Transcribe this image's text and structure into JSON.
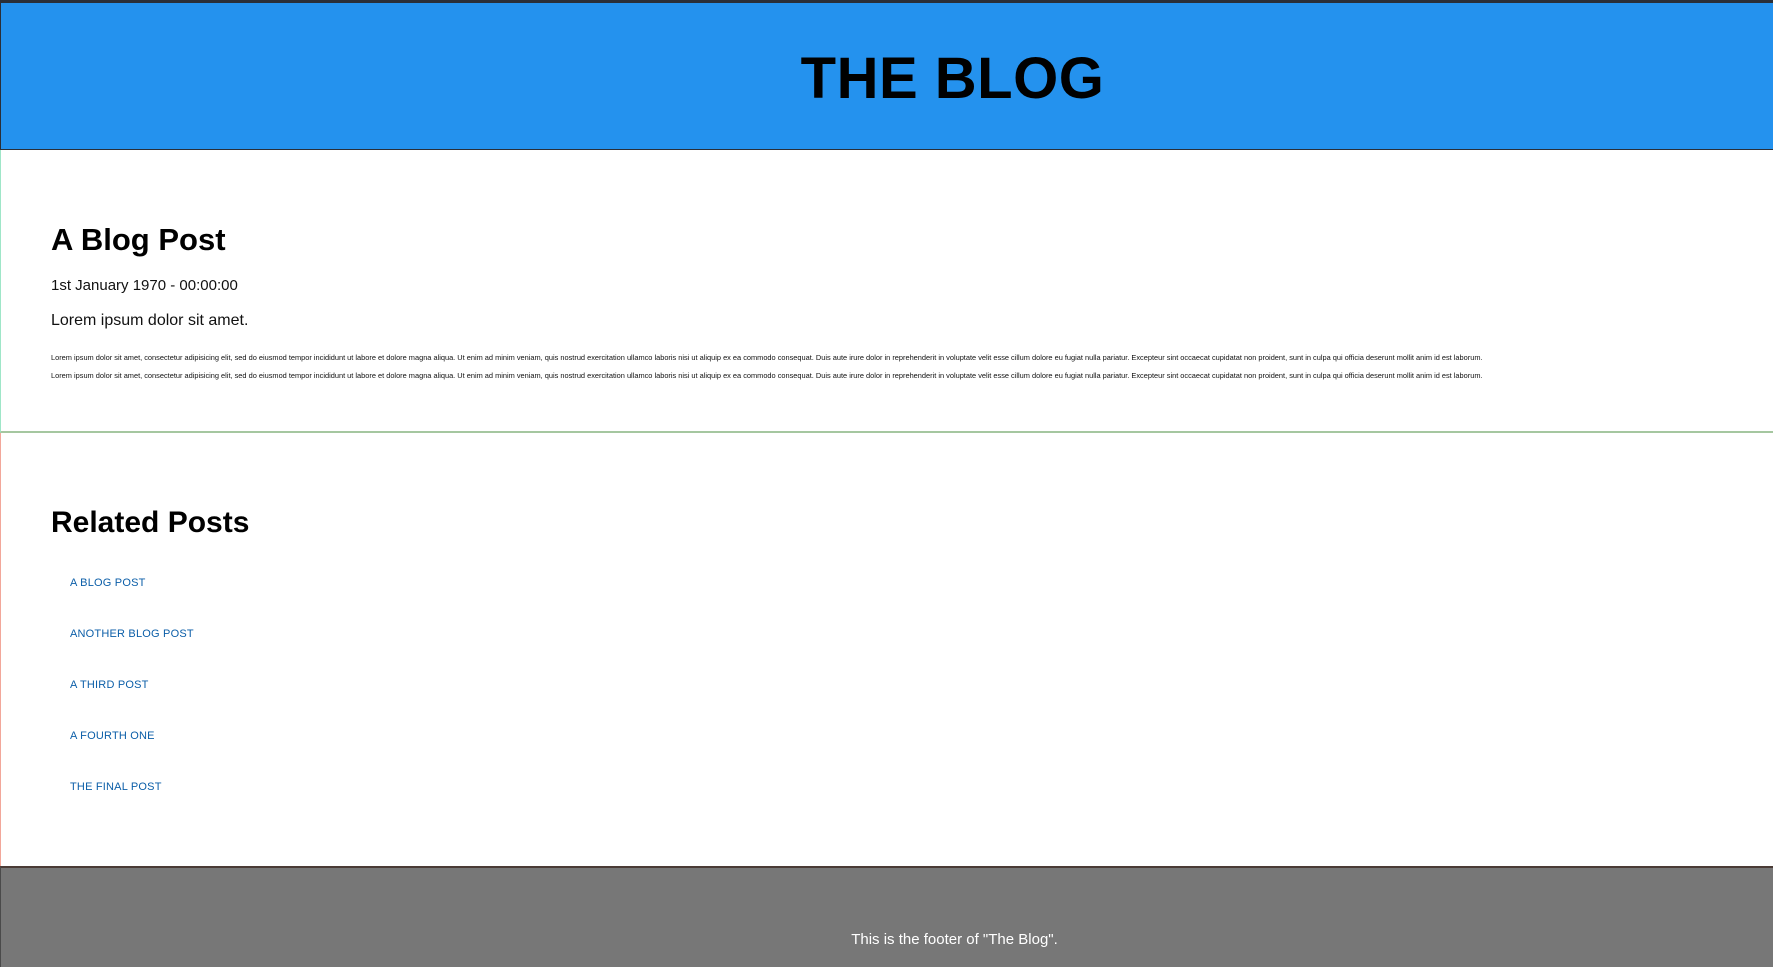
{
  "header": {
    "title": "THE BLOG"
  },
  "post": {
    "title": "A Blog Post",
    "date": "1st January 1970 - 00:00:00",
    "lead": "Lorem ipsum dolor sit amet.",
    "paragraphs": [
      "Lorem ipsum dolor sit amet, consectetur adipisicing elit, sed do eiusmod tempor incididunt ut labore et dolore magna aliqua. Ut enim ad minim veniam, quis nostrud exercitation ullamco laboris nisi ut aliquip ex ea commodo consequat. Duis aute irure dolor in reprehenderit in voluptate velit esse cillum dolore eu fugiat nulla pariatur. Excepteur sint occaecat cupidatat non proident, sunt in culpa qui officia deserunt mollit anim id est laborum.",
      "Lorem ipsum dolor sit amet, consectetur adipisicing elit, sed do eiusmod tempor incididunt ut labore et dolore magna aliqua. Ut enim ad minim veniam, quis nostrud exercitation ullamco laboris nisi ut aliquip ex ea commodo consequat. Duis aute irure dolor in reprehenderit in voluptate velit esse cillum dolore eu fugiat nulla pariatur. Excepteur sint occaecat cupidatat non proident, sunt in culpa qui officia deserunt mollit anim id est laborum."
    ]
  },
  "related": {
    "title": "Related Posts",
    "links": [
      "A BLOG POST",
      "ANOTHER BLOG POST",
      "A THIRD POST",
      "A FOURTH ONE",
      "THE FINAL POST"
    ]
  },
  "footer": {
    "text": "This is the footer of \"The Blog\"."
  },
  "colors": {
    "header_bg": "#2492ee",
    "link": "#0b5ea8",
    "footer_bg": "#777777"
  }
}
